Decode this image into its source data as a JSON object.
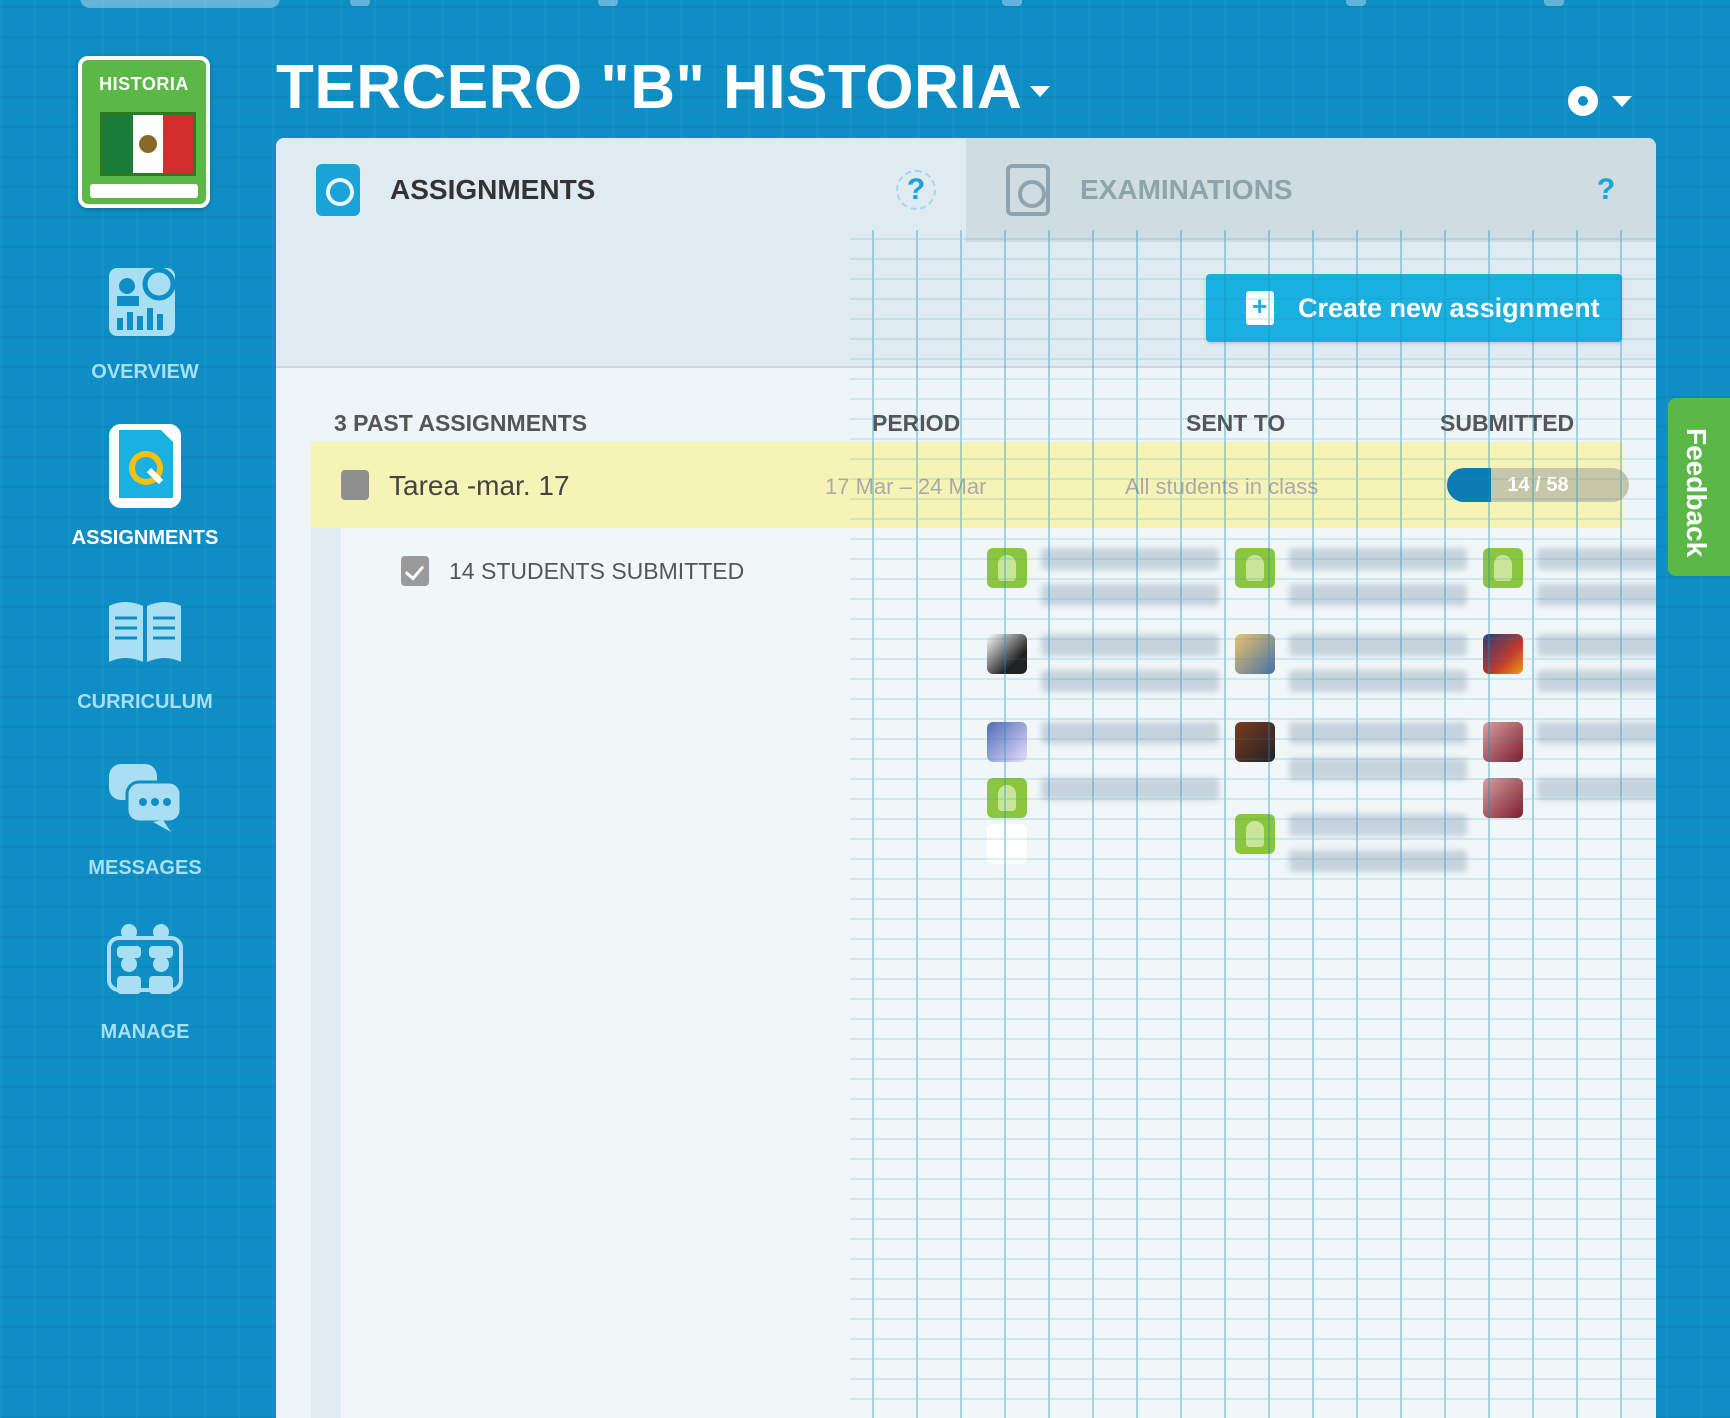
{
  "course": {
    "badge_label": "HISTORIA",
    "title": "TERCERO \"B\" HISTORIA"
  },
  "sidebar": {
    "items": [
      {
        "label": "OVERVIEW",
        "icon": "overview-icon"
      },
      {
        "label": "ASSIGNMENTS",
        "icon": "assignment-icon",
        "active": true
      },
      {
        "label": "CURRICULUM",
        "icon": "book-icon"
      },
      {
        "label": "MESSAGES",
        "icon": "chat-bubbles-icon"
      },
      {
        "label": "MANAGE",
        "icon": "people-icon"
      }
    ]
  },
  "tabs": [
    {
      "label": "ASSIGNMENTS",
      "help": "?",
      "active": true
    },
    {
      "label": "EXAMINATIONS",
      "help": "?",
      "active": false
    }
  ],
  "toolbar": {
    "create_label": "Create new assignment"
  },
  "list": {
    "count_label": "3 PAST ASSIGNMENTS",
    "columns": {
      "period": "PERIOD",
      "sent_to": "SENT TO",
      "submitted": "SUBMITTED"
    }
  },
  "assignment": {
    "title": "Tarea -mar. 17",
    "period": "17 Mar – 24 Mar",
    "sent_to": "All students in class",
    "submitted_text": "14 / 58",
    "submitted_fraction": 0.2414
  },
  "detail": {
    "submitted_label": "14 STUDENTS SUBMITTED"
  },
  "feedback": {
    "label": "Feedback"
  },
  "colors": {
    "background": "#0e8ec4",
    "accent": "#1ab0e0",
    "highlight_row": "#f5f4b6",
    "badge_green": "#5bb847"
  }
}
